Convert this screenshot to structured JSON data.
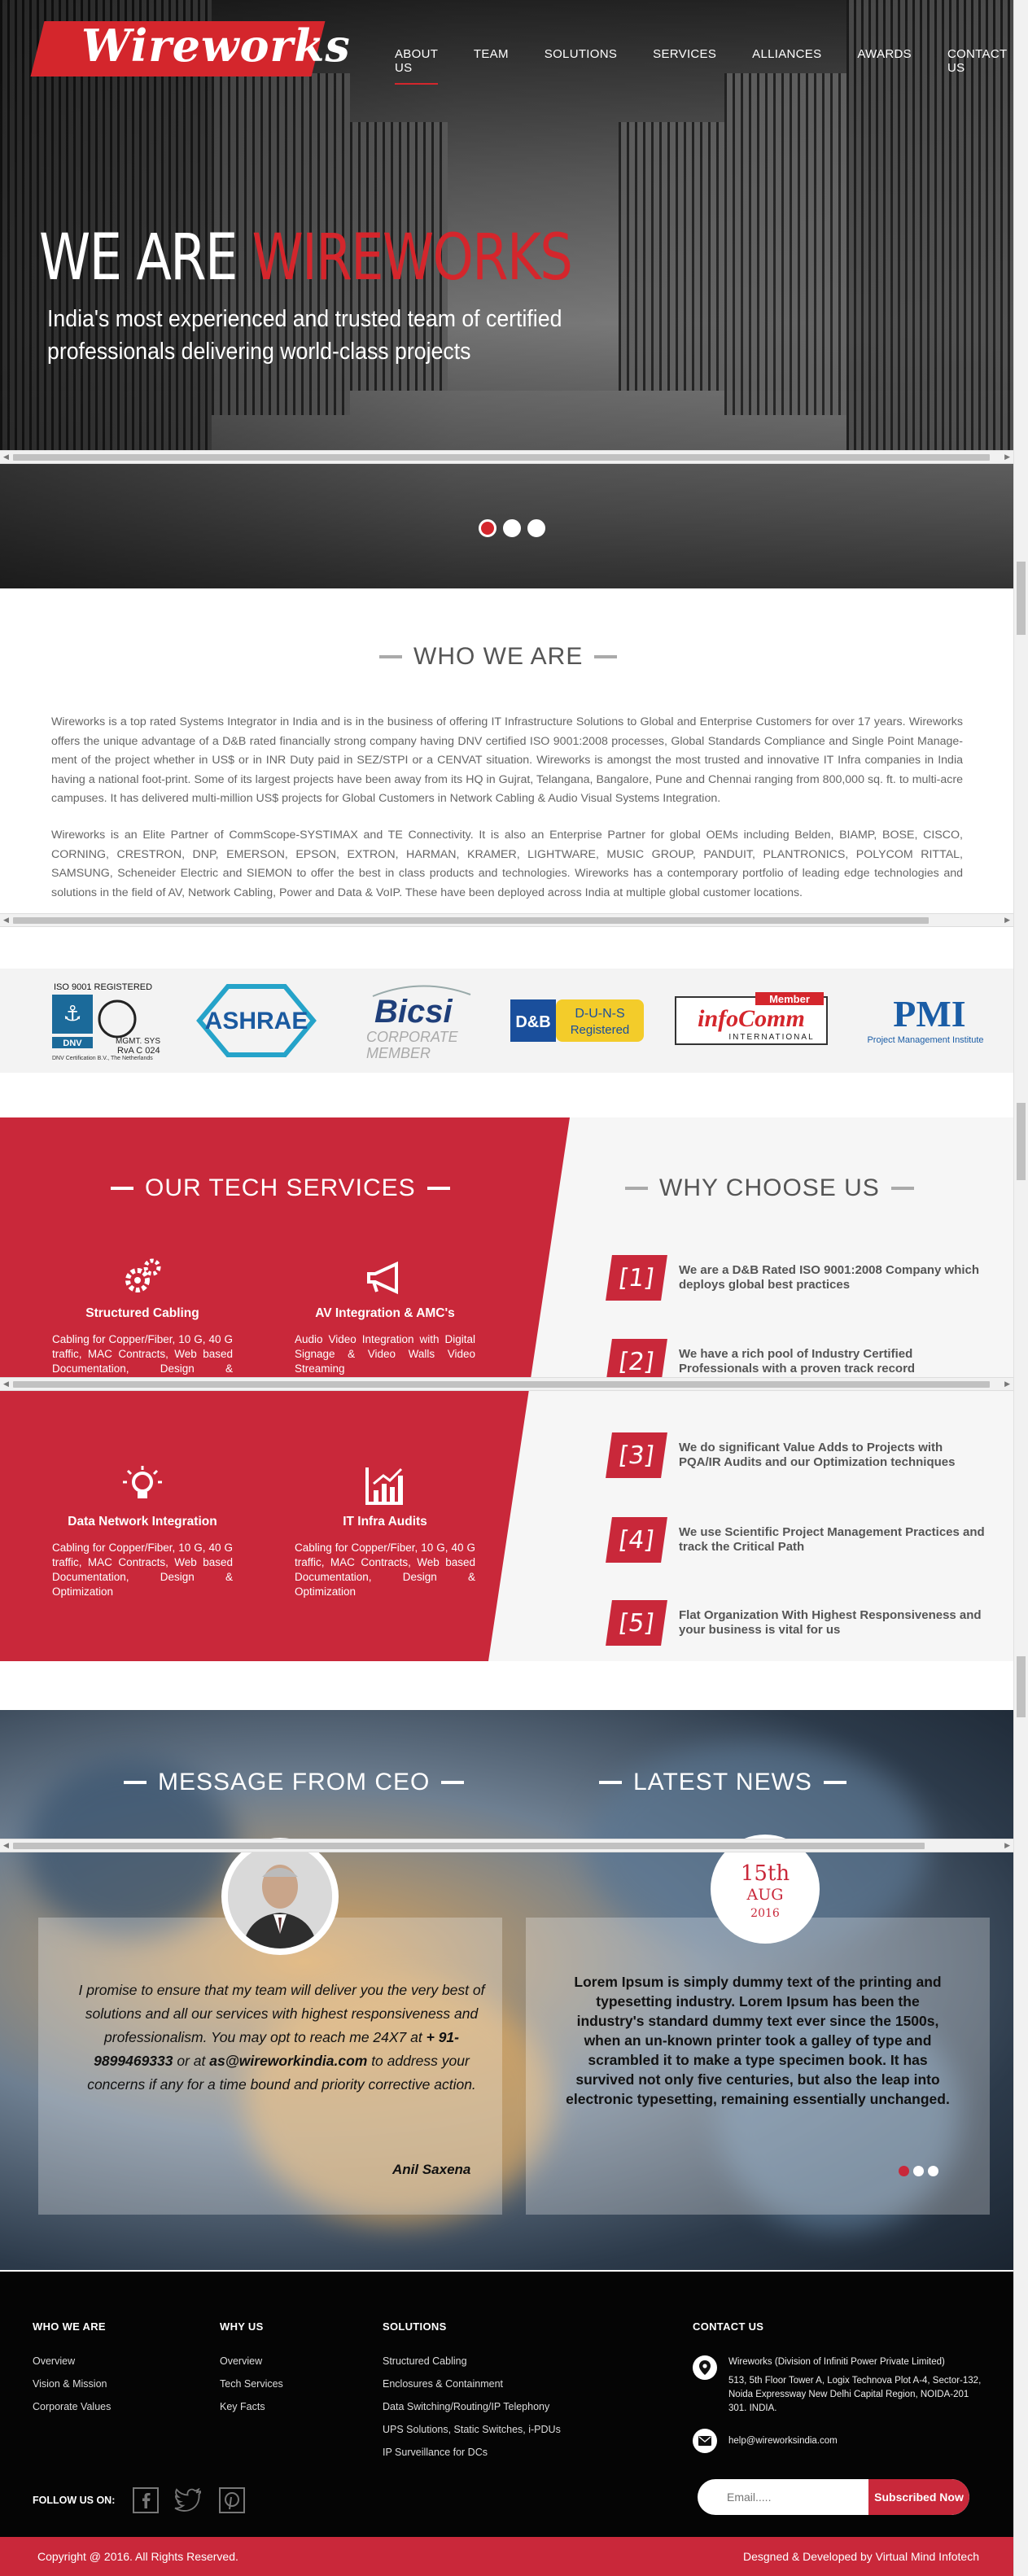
{
  "brand": {
    "logo_text": "Wireworks",
    "primary_color": "#d4262c",
    "accent_color": "#c9283a"
  },
  "nav": {
    "items": [
      {
        "label": "ABOUT US",
        "active": true
      },
      {
        "label": "TEAM"
      },
      {
        "label": "SOLUTIONS"
      },
      {
        "label": "SERVICES"
      },
      {
        "label": "ALLIANCES"
      },
      {
        "label": "AWARDS"
      },
      {
        "label": "CONTACT US"
      }
    ]
  },
  "hero": {
    "title_prefix": "WE ARE ",
    "title_highlight": "WIREWORKS",
    "subtitle_line1": "India's most experienced and trusted team of certified",
    "subtitle_line2": "professionals delivering world-class projects",
    "slides": 3,
    "active_slide": 1
  },
  "who": {
    "title": "WHO WE ARE",
    "para1_a": "Wireworks is a top rated Systems Integrator in India and is in the business of offering IT Infrastructure Solutions to Global and Enterprise Customers for over 17 years. Wireworks offers the unique advantage of a D&B rated financially strong company having DNV certified ISO 9001:2008 processes, Global Standards Compliance and Single Point Manage-ment of the project whether in US$ or in INR Duty paid in SEZ/STPI or a CENVAT situation. Wireworks is amongst the most trusted and innovative IT Infra companies in India having a national foot-print. Some of its largest projects have been away from its HQ in Gujrat, Telangana, Bangalore, Pune and Chennai ranging from 800,000 sq. ft. to multi-acre campuses. It has delivered multi-million US$ projects for Global Customers in  Network Cabling & Audio Visual Systems Integration.",
    "para2_a": "Wireworks is an Elite Partner of CommScope-SYSTIMAX and TE Connectivity. It is also an Enterprise Partner for global OEMs including Belden, BIAMP, BOSE, CISCO, CORNING, CRESTRON, DNP, EMERSON,  EPSON, EXTRON, HARMAN, KRAMER, LIGHTWARE, MUSIC GROUP, PANDUIT, PLANTRONICS, POLYCOM RITTAL, SAMSUNG, Scheneider Electric and SIEMON to offer the best in class products and technologies. Wireworks has a contemporary portfolio of leading edge technologies and solutions in the field of AV, Network Cabling, Power and Data & VoIP. These have been deployed across India at multiple global customer locations."
  },
  "logos": {
    "iso_top": "ISO 9001 REGISTERED",
    "iso_mgmt": "MGMT. SYS",
    "iso_rva": "RvA C 024",
    "iso_dnv": "DNV",
    "iso_caption": "DNV Certification B.V., The Netherlands",
    "ashrae": "ASHRAE",
    "bicsi": "Bicsi",
    "bicsi_sub1": "CORPORATE",
    "bicsi_sub2": "MEMBER",
    "dnb": "D&B",
    "duns": "D-U-N-S",
    "duns_sub": "Registered",
    "infocomm_member": "Member",
    "infocomm": "infoComm",
    "infocomm_sub": "INTERNATIONAL",
    "pmi": "PMI",
    "pmi_sub": "Project Management Institute"
  },
  "services": {
    "title": "OUR TECH SERVICES",
    "items": [
      {
        "icon": "gears-icon",
        "name": "Structured Cabling",
        "desc": "Cabling for Copper/Fiber, 10 G, 40 G traffic, MAC Contracts, Web based Documentation, Design & Optimization"
      },
      {
        "icon": "megaphone-icon",
        "name": "AV Integration & AMC's",
        "desc": "Audio Video Integration with Digital Signage & Video Walls Video Streaming"
      },
      {
        "icon": "lightbulb-icon",
        "name": "Data Network Integration",
        "desc": "Cabling for Copper/Fiber, 10 G, 40 G traffic, MAC Contracts, Web based Documentation, Design & Optimization"
      },
      {
        "icon": "chart-icon",
        "name": "IT Infra Audits",
        "desc": "Cabling for Copper/Fiber, 10 G, 40 G traffic, MAC Contracts, Web based Documentation, Design & Optimization"
      }
    ]
  },
  "why": {
    "title": "WHY CHOOSE US",
    "items": [
      {
        "num": "[1]",
        "text": "We are a D&B Rated ISO 9001:2008 Company which deploys global best practices"
      },
      {
        "num": "[2]",
        "text": "We have a rich pool of Industry Certified Professionals with a proven track record"
      },
      {
        "num": "[3]",
        "text": "We do significant Value Adds to Projects with PQA/IR Audits and our Optimization techniques"
      },
      {
        "num": "[4]",
        "text": "We use Scientific Project Management Practices and track the Critical Path"
      },
      {
        "num": "[5]",
        "text": "Flat Organization With Highest Responsiveness and your business is vital for us"
      }
    ]
  },
  "ceo": {
    "title": "MESSAGE FROM CEO",
    "quote_a": "I promise to ensure that my team will deliver you the very best of solutions and all our services with highest responsiveness and professionalism. You may opt to reach me 24X7 at ",
    "phone": "+ 91-9899469333",
    "quote_b": " or at ",
    "email": "as@wireworkindia.com",
    "quote_c": " to address your concerns if any for a time bound and priority corrective action.",
    "name": "Anil Saxena"
  },
  "news": {
    "title": "LATEST NEWS",
    "day": "15th",
    "month": "AUG",
    "year": "2016",
    "text": "Lorem Ipsum is simply dummy text of the printing and typesetting industry. Lorem Ipsum has been the industry's standard dummy text ever since the 1500s, when an un-known printer took a galley of type and scrambled it to make a type specimen book. It has survived not only five centuries, but also the leap into electronic typesetting, remaining essentially unchanged."
  },
  "footer": {
    "who": {
      "head": "WHO WE ARE",
      "links": [
        "Overview",
        "Vision & Mission",
        "Corporate Values"
      ]
    },
    "why": {
      "head": "WHY US",
      "links": [
        "Overview",
        "Tech Services",
        "Key Facts"
      ]
    },
    "solutions": {
      "head": "SOLUTIONS",
      "links": [
        "Structured Cabling",
        "Enclosures & Containment",
        "Data Switching/Routing/IP Telephony",
        "UPS Solutions, Static Switches, i-PDUs",
        "IP Surveillance for DCs"
      ]
    },
    "contact": {
      "head": "CONTACT US",
      "address_l1": "Wireworks (Division of Infiniti Power Private Limited)",
      "address_l2": "513, 5th Floor Tower A, Logix Technova Plot A-4, Sector-132, Noida Expressway New Delhi Capital Region, NOIDA-201 301. INDIA.",
      "email": "help@wireworksindia.com"
    },
    "follow": "FOLLOW US ON:",
    "email_placeholder": "Email.....",
    "subscribe": "Subscribed Now",
    "copyright": "Copyright @ 2016. All Rights Reserved.",
    "credit": "Desgned & Developed by  Virtual Mind Infotech"
  }
}
